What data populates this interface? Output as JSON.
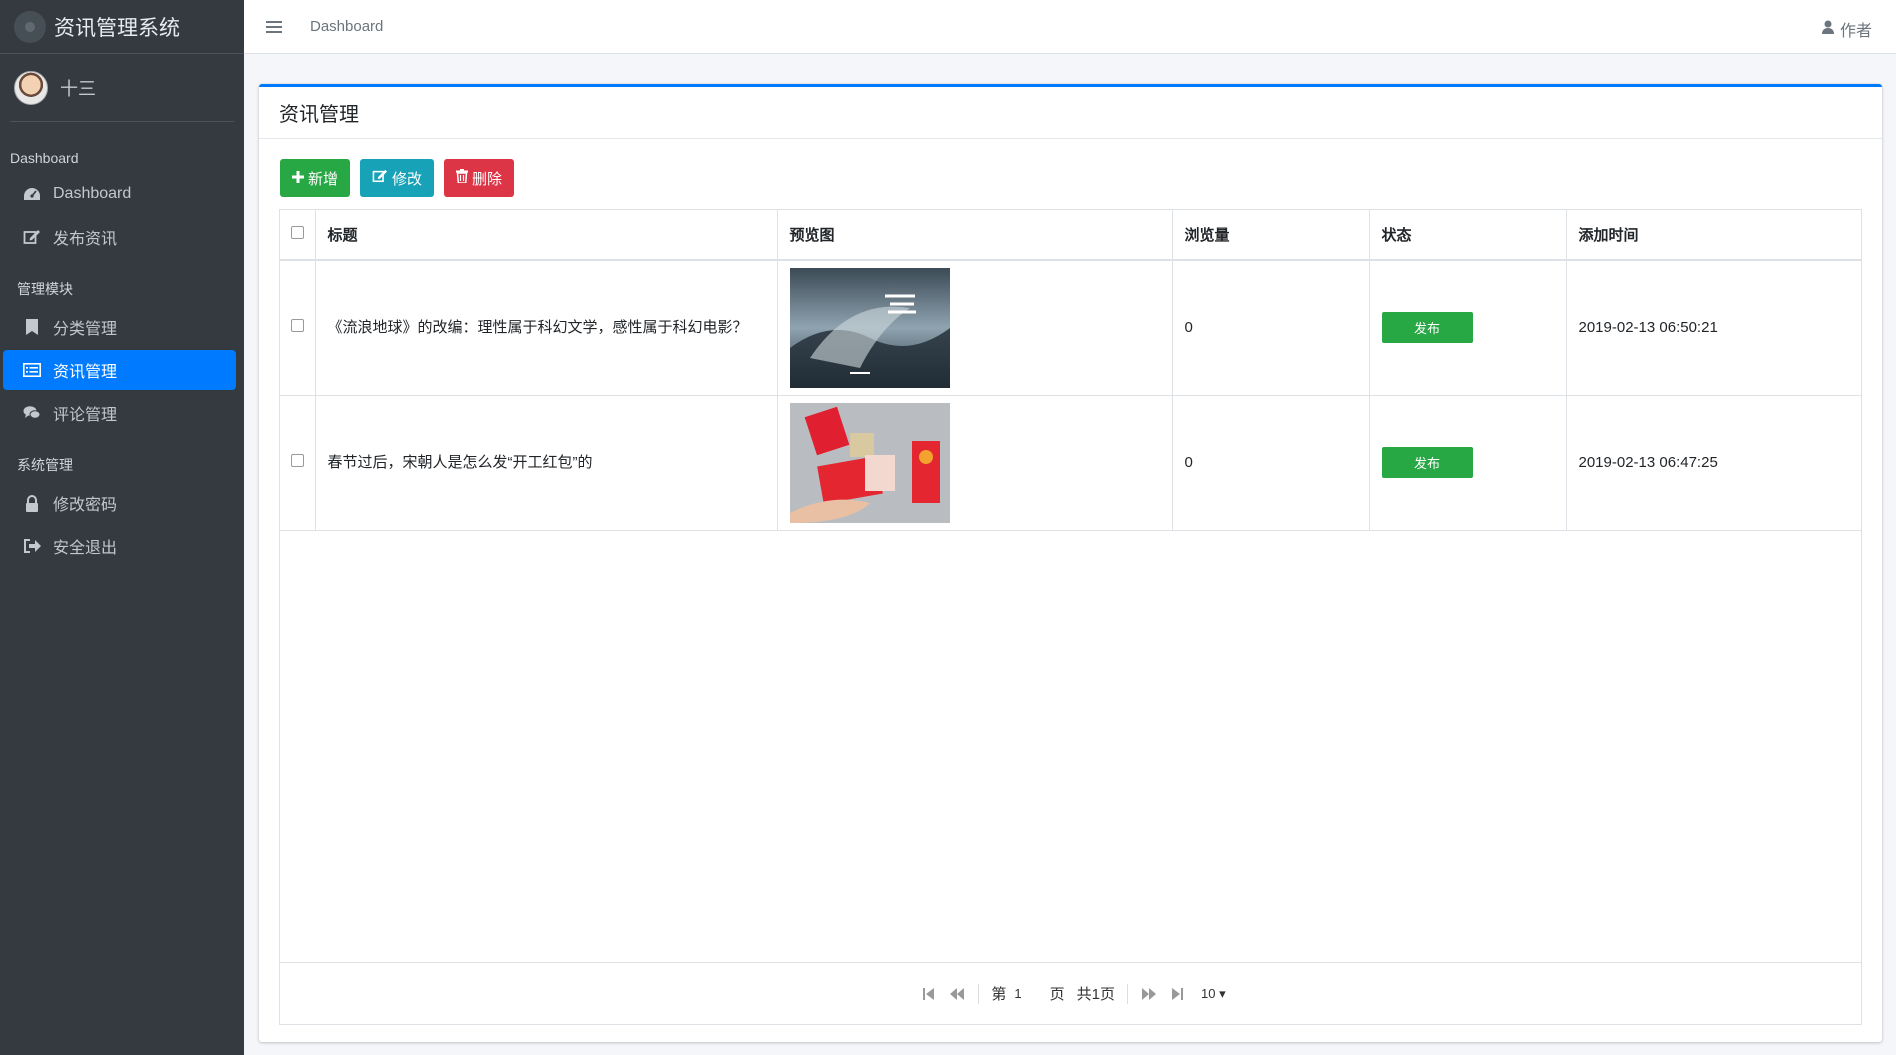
{
  "brand": {
    "title": "资讯管理系统"
  },
  "user": {
    "name": "十三"
  },
  "sidebar": {
    "header1": "Dashboard",
    "items1": [
      {
        "label": "Dashboard",
        "icon": "dashboard-icon"
      },
      {
        "label": "发布资讯",
        "icon": "edit-icon"
      }
    ],
    "header2": "管理模块",
    "items2": [
      {
        "label": "分类管理",
        "icon": "bookmark-icon"
      },
      {
        "label": "资讯管理",
        "icon": "list-icon",
        "active": true
      },
      {
        "label": "评论管理",
        "icon": "comments-icon"
      }
    ],
    "header3": "系统管理",
    "items3": [
      {
        "label": "修改密码",
        "icon": "lock-icon"
      },
      {
        "label": "安全退出",
        "icon": "sign-out-icon"
      }
    ]
  },
  "topbar": {
    "breadcrumb": "Dashboard",
    "author": "作者"
  },
  "card": {
    "title": "资讯管理"
  },
  "toolbar": {
    "add_label": "新增",
    "edit_label": "修改",
    "delete_label": "删除"
  },
  "table": {
    "headers": {
      "title": "标题",
      "preview": "预览图",
      "views": "浏览量",
      "status": "状态",
      "added": "添加时间"
    },
    "rows": [
      {
        "title": "《流浪地球》的改编：理性属于科幻文学，感性属于科幻电影？",
        "views": "0",
        "status": "发布",
        "added": "2019-02-13 06:50:21"
      },
      {
        "title": "春节过后，宋朝人是怎么发“开工红包”的",
        "views": "0",
        "status": "发布",
        "added": "2019-02-13 06:47:25"
      }
    ]
  },
  "pager": {
    "prefix": "第",
    "page": "1",
    "suffix": "页",
    "total": "共1页",
    "size": "10"
  },
  "colors": {
    "sidebar": "#343a40",
    "accent": "#007bff",
    "success": "#28a745",
    "info": "#17a2b8",
    "danger": "#dc3545"
  }
}
